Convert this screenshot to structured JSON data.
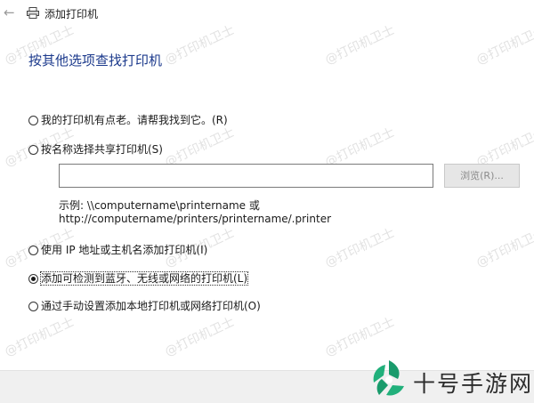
{
  "window": {
    "title": "添加打印机"
  },
  "heading": "按其他选项查找打印机",
  "options": [
    {
      "label": "我的打印机有点老。请帮我找到它。(R)",
      "checked": false
    },
    {
      "label": "按名称选择共享打印机(S)",
      "checked": false
    },
    {
      "label": "使用 IP 地址或主机名添加打印机(I)",
      "checked": false
    },
    {
      "label": "添加可检测到蓝牙、无线或网络的打印机(L)",
      "checked": true
    },
    {
      "label": "通过手动设置添加本地打印机或网络打印机(O)",
      "checked": false
    }
  ],
  "share": {
    "input_value": "",
    "browse_label": "浏览(R)..."
  },
  "example": {
    "line1": "示例: \\\\computername\\printername 或",
    "line2": "http://computername/printers/printername/.printer"
  },
  "watermark": "@打印机卫士",
  "brand": {
    "name": "十号手游网",
    "color": "#1a9b6c"
  }
}
